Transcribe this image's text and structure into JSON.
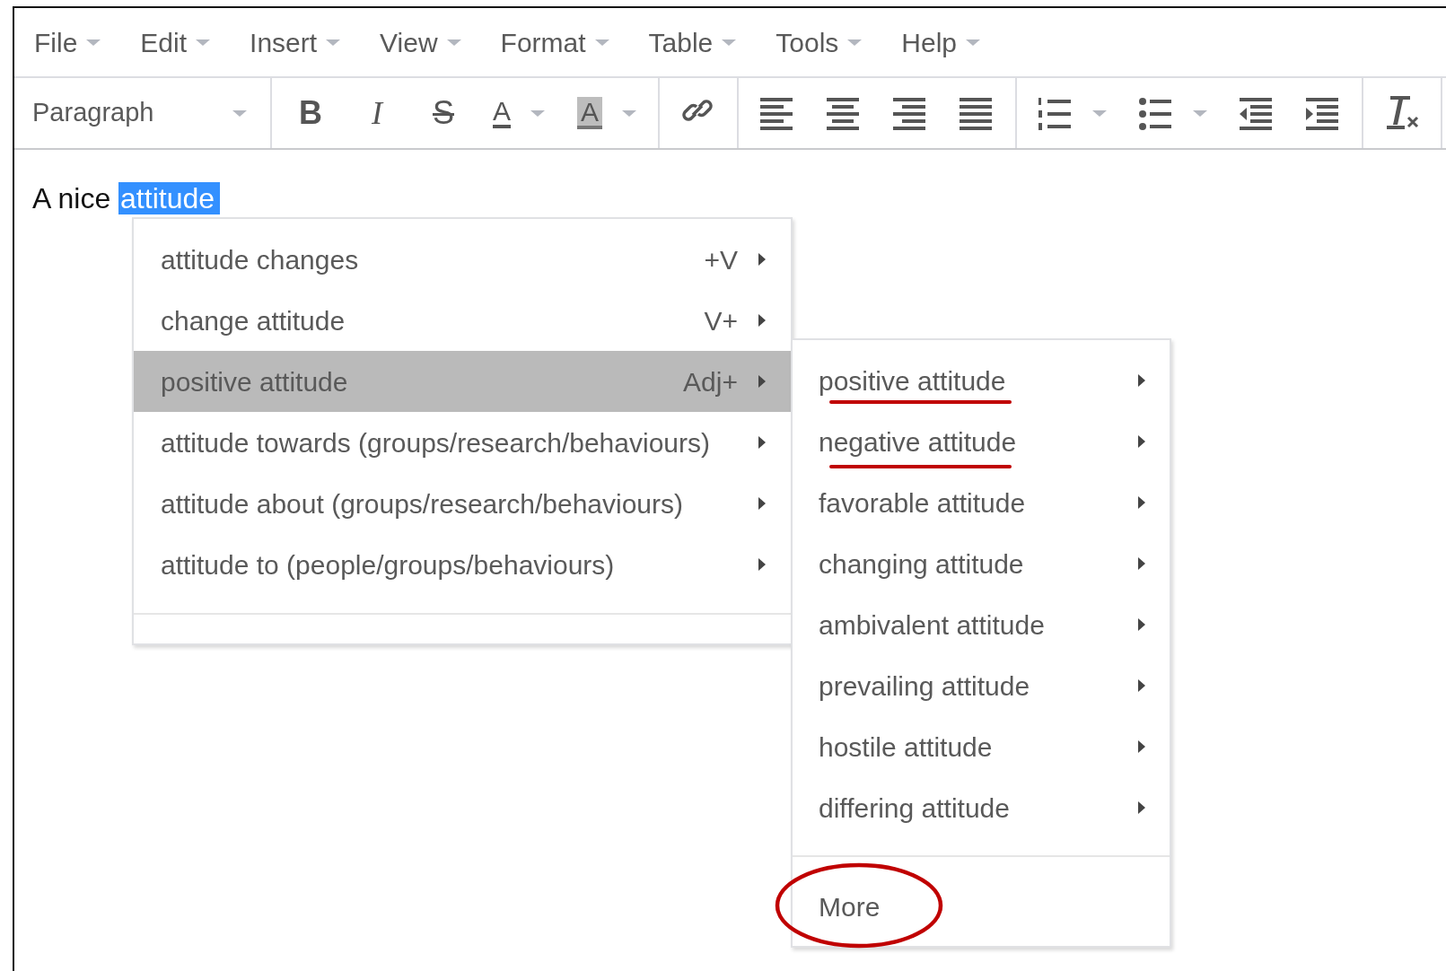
{
  "menubar": [
    {
      "label": "File"
    },
    {
      "label": "Edit"
    },
    {
      "label": "Insert"
    },
    {
      "label": "View"
    },
    {
      "label": "Format"
    },
    {
      "label": "Table"
    },
    {
      "label": "Tools"
    },
    {
      "label": "Help"
    }
  ],
  "toolbar": {
    "format_select": {
      "value": "Paragraph"
    },
    "groups": [
      [
        {
          "kind": "bold",
          "label": "B",
          "has_caret": false
        },
        {
          "kind": "italic",
          "label": "I",
          "has_caret": false
        },
        {
          "kind": "strikethrough",
          "label": "S",
          "has_caret": false
        },
        {
          "kind": "text-color",
          "label": "A",
          "has_caret": true
        },
        {
          "kind": "background-color",
          "label": "A",
          "has_caret": true
        }
      ],
      [
        {
          "kind": "link",
          "has_caret": false
        }
      ],
      [
        {
          "kind": "align-left",
          "has_caret": false
        },
        {
          "kind": "align-center",
          "has_caret": false
        },
        {
          "kind": "align-right",
          "has_caret": false
        },
        {
          "kind": "align-justify",
          "has_caret": false
        }
      ],
      [
        {
          "kind": "numbered-list",
          "has_caret": true
        },
        {
          "kind": "bullet-list",
          "has_caret": true
        },
        {
          "kind": "outdent",
          "has_caret": false
        },
        {
          "kind": "indent",
          "has_caret": false
        }
      ],
      [
        {
          "kind": "clear-formatting",
          "has_caret": false
        }
      ]
    ]
  },
  "editor": {
    "text_before": "A nice ",
    "selected_text": "attitude"
  },
  "context_menu": {
    "items": [
      {
        "label": "attitude changes",
        "shortcut": "+V",
        "selected": false
      },
      {
        "label": "change attitude",
        "shortcut": "V+",
        "selected": false
      },
      {
        "label": "positive attitude",
        "shortcut": "Adj+",
        "selected": true
      },
      {
        "label": "attitude towards (groups/research/behaviours)",
        "selected": false
      },
      {
        "label": "attitude about (groups/research/behaviours)",
        "selected": false
      },
      {
        "label": "attitude to (people/groups/behaviours)",
        "selected": false
      }
    ]
  },
  "submenu": {
    "items": [
      {
        "label": "positive attitude",
        "underlined": true
      },
      {
        "label": "negative attitude",
        "underlined": true
      },
      {
        "label": "favorable attitude",
        "underlined": false
      },
      {
        "label": "changing attitude",
        "underlined": false
      },
      {
        "label": "ambivalent attitude",
        "underlined": false
      },
      {
        "label": "prevailing attitude",
        "underlined": false
      },
      {
        "label": "hostile attitude",
        "underlined": false
      },
      {
        "label": "differing attitude",
        "underlined": false
      }
    ],
    "more": {
      "label": "More",
      "circled": true
    }
  }
}
